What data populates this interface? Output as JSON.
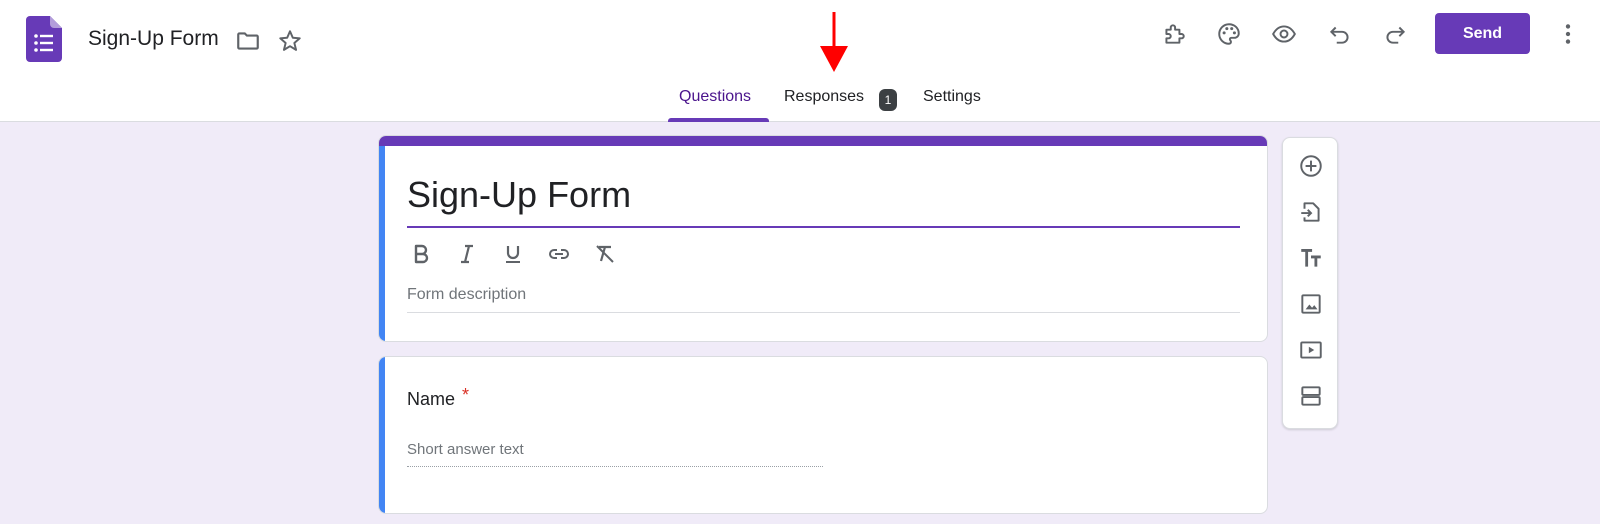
{
  "app": {
    "doc_title": "Sign-Up Form",
    "send_label": "Send",
    "accent": "#673ab7"
  },
  "tabs": [
    {
      "label": "Questions",
      "active": true
    },
    {
      "label": "Responses",
      "badge": "1"
    },
    {
      "label": "Settings"
    }
  ],
  "toolbar_icons": [
    "add-ons-icon",
    "palette-icon",
    "preview-icon",
    "undo-icon",
    "redo-icon",
    "more-vert-icon"
  ],
  "form": {
    "title": "Sign-Up Form",
    "description_placeholder": "Form description",
    "format_tools": [
      "bold-icon",
      "italic-icon",
      "underline-icon",
      "link-icon",
      "clear-format-icon"
    ]
  },
  "question": {
    "label": "Name",
    "required_mark": "*",
    "answer_placeholder": "Short answer text"
  },
  "side_tools": [
    "add-question-icon",
    "import-questions-icon",
    "add-title-icon",
    "add-image-icon",
    "add-video-icon",
    "add-section-icon"
  ]
}
